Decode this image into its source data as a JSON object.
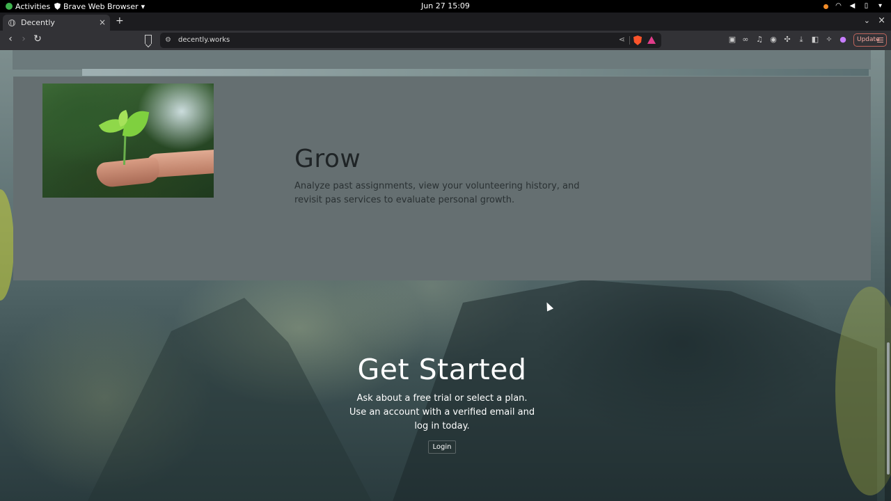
{
  "system_bar": {
    "activities_label": "Activities",
    "app_name": "Brave Web Browser",
    "app_dropdown": "▾",
    "clock": "Jun 27  15:09",
    "icons": [
      "notification-dot-icon",
      "wifi-icon",
      "volume-icon",
      "battery-icon",
      "power-menu-icon"
    ]
  },
  "browser": {
    "tabs": [
      {
        "label": "Decently",
        "close": "×"
      }
    ],
    "new_tab": "+",
    "tab_list_chevron": "⌄",
    "window_close": "×",
    "back": "‹",
    "forward": "›",
    "reload": "↻",
    "url": "decently.works",
    "update_label": "Update"
  },
  "page": {
    "feature": {
      "title": "Grow",
      "description": "Analyze past assignments, view your volunteering history, and revisit pas services to evaluate personal growth."
    },
    "cta": {
      "title": "Get Started",
      "description": "Ask about a free trial or select a plan. Use an account with a verified email and log in today.",
      "login_label": "Login"
    }
  },
  "colors": {
    "brave_orange": "#fb542b",
    "card_bg": "#656f71",
    "update_border": "#c0655c"
  }
}
